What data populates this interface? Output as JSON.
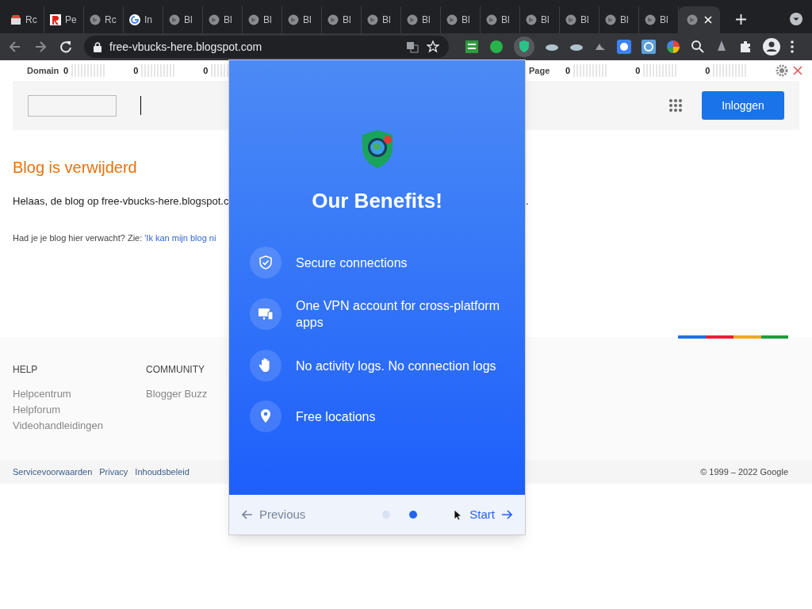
{
  "browser": {
    "tabs": [
      {
        "label": "Rc",
        "selected": false
      },
      {
        "label": "Pe",
        "selected": false
      },
      {
        "label": "Rc",
        "selected": false
      },
      {
        "label": "In",
        "selected": false
      },
      {
        "label": "Bl",
        "selected": false
      },
      {
        "label": "Bl",
        "selected": false
      },
      {
        "label": "Bl",
        "selected": false
      },
      {
        "label": "Bl",
        "selected": false
      },
      {
        "label": "Bl",
        "selected": false
      },
      {
        "label": "Bl",
        "selected": false
      },
      {
        "label": "Bl",
        "selected": false
      },
      {
        "label": "Bl",
        "selected": false
      },
      {
        "label": "Bl",
        "selected": false
      },
      {
        "label": "Bl",
        "selected": false
      },
      {
        "label": "Bl",
        "selected": false
      },
      {
        "label": "Bl",
        "selected": false
      },
      {
        "label": "Bl",
        "selected": false
      },
      {
        "selected": true
      }
    ],
    "address": "free-vbucks-here.blogspot.com"
  },
  "seo_bar": {
    "domain": {
      "label": "Domain",
      "p": "0",
      "t": "0",
      "pt": "0"
    },
    "page": {
      "label": "Page",
      "p": "0",
      "t": "0",
      "pt": "0"
    }
  },
  "header": {
    "login_button": "Inloggen"
  },
  "content": {
    "title": "Blog is verwijderd",
    "message": "Helaas, de blog op free-vbucks-here.blogspot.c",
    "message_end": ".",
    "question": "Had je je blog hier verwacht? Zie:",
    "question_link": "'Ik kan mijn blog ni"
  },
  "footer": {
    "columns": [
      {
        "heading": "HELP",
        "links": [
          "Helpcentrum",
          "Helpforum",
          "Videohandleidingen"
        ]
      },
      {
        "heading": "COMMUNITY",
        "links": [
          "Blogger Buzz"
        ]
      }
    ],
    "bottom_links": [
      "Servicevoorwaarden",
      "Privacy",
      "Inhoudsbeleid"
    ],
    "copyright": "© 1999 – 2022 Google"
  },
  "popup": {
    "title": "Our Benefits!",
    "benefits": [
      {
        "text": "Secure connections"
      },
      {
        "text": "One VPN account for cross-platform apps"
      },
      {
        "text": "No activity logs. No connection logs"
      },
      {
        "text": "Free locations"
      }
    ],
    "previous": "Previous",
    "next": "Start",
    "pages": [
      {
        "selected": false
      },
      {
        "selected": true
      }
    ]
  }
}
